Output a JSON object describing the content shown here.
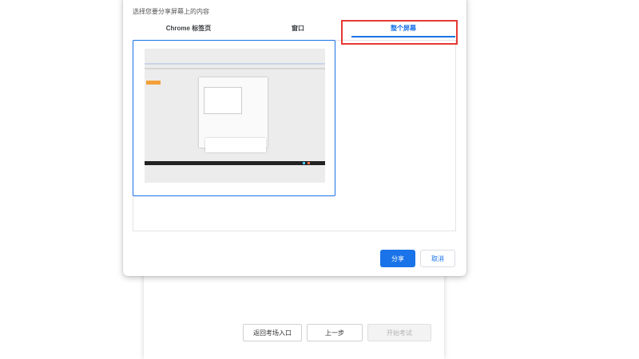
{
  "share_dialog": {
    "prompt": "选择您要分享屏幕上的内容",
    "tabs": [
      {
        "label": "Chrome 标签页",
        "active": false
      },
      {
        "label": "窗口",
        "active": false
      },
      {
        "label": "整个屏幕",
        "active": true
      }
    ],
    "share_label": "分享",
    "cancel_label": "取消"
  },
  "exam_page": {
    "return_label": "返回考场入口",
    "prev_label": "上一步",
    "start_label": "开始考试"
  },
  "colors": {
    "accent": "#1a73e8",
    "annotation": "#e53935"
  }
}
